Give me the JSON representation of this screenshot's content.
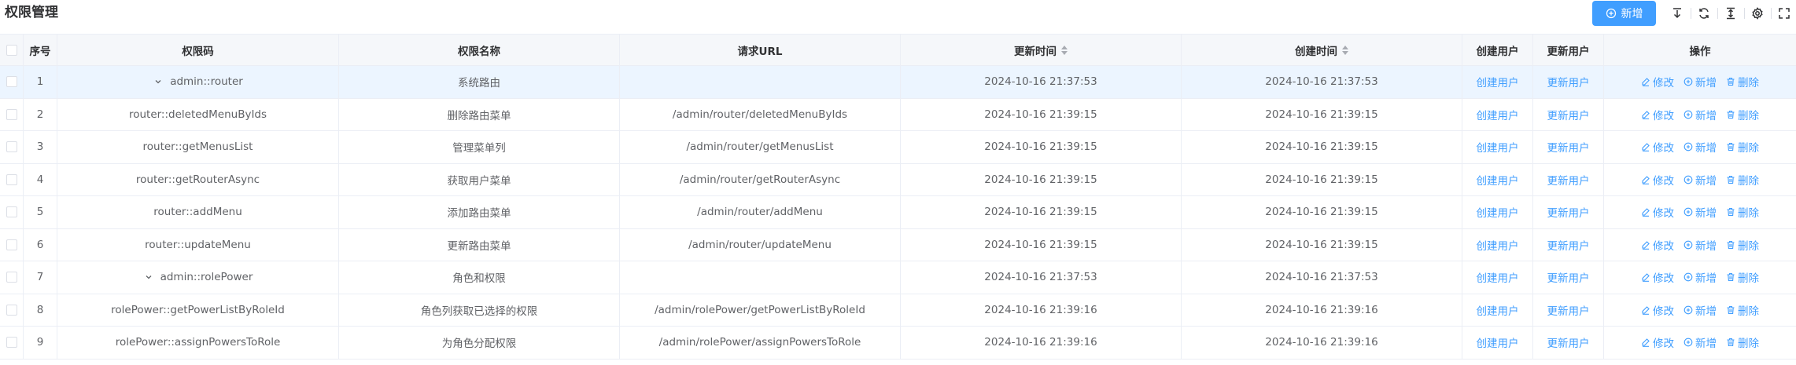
{
  "header": {
    "title": "权限管理",
    "add_label": "新增"
  },
  "toolbar": {
    "icons": [
      "export-icon",
      "refresh-icon",
      "column-height-icon",
      "settings-icon",
      "fullscreen-icon"
    ]
  },
  "columns": {
    "seq": "序号",
    "code": "权限码",
    "name": "权限名称",
    "url": "请求URL",
    "updated": "更新时间",
    "created": "创建时间",
    "create_user": "创建用户",
    "update_user": "更新用户",
    "ops": "操作"
  },
  "ops_labels": {
    "edit": "修改",
    "add": "新增",
    "delete": "删除"
  },
  "rows": [
    {
      "seq": "1",
      "code": "admin::router",
      "name": "系统路由",
      "url": "",
      "updated": "2024-10-16 21:37:53",
      "created": "2024-10-16 21:37:53",
      "create_user": "创建用户",
      "update_user": "更新用户"
    },
    {
      "seq": "2",
      "code": "router::deletedMenuByIds",
      "name": "删除路由菜单",
      "url": "/admin/router/deletedMenuByIds",
      "updated": "2024-10-16 21:39:15",
      "created": "2024-10-16 21:39:15",
      "create_user": "创建用户",
      "update_user": "更新用户"
    },
    {
      "seq": "3",
      "code": "router::getMenusList",
      "name": "管理菜单列",
      "url": "/admin/router/getMenusList",
      "updated": "2024-10-16 21:39:15",
      "created": "2024-10-16 21:39:15",
      "create_user": "创建用户",
      "update_user": "更新用户"
    },
    {
      "seq": "4",
      "code": "router::getRouterAsync",
      "name": "获取用户菜单",
      "url": "/admin/router/getRouterAsync",
      "updated": "2024-10-16 21:39:15",
      "created": "2024-10-16 21:39:15",
      "create_user": "创建用户",
      "update_user": "更新用户"
    },
    {
      "seq": "5",
      "code": "router::addMenu",
      "name": "添加路由菜单",
      "url": "/admin/router/addMenu",
      "updated": "2024-10-16 21:39:15",
      "created": "2024-10-16 21:39:15",
      "create_user": "创建用户",
      "update_user": "更新用户"
    },
    {
      "seq": "6",
      "code": "router::updateMenu",
      "name": "更新路由菜单",
      "url": "/admin/router/updateMenu",
      "updated": "2024-10-16 21:39:15",
      "created": "2024-10-16 21:39:15",
      "create_user": "创建用户",
      "update_user": "更新用户"
    },
    {
      "seq": "7",
      "code": "admin::rolePower",
      "name": "角色和权限",
      "url": "",
      "updated": "2024-10-16 21:37:53",
      "created": "2024-10-16 21:37:53",
      "create_user": "创建用户",
      "update_user": "更新用户"
    },
    {
      "seq": "8",
      "code": "rolePower::getPowerListByRoleId",
      "name": "角色列获取已选择的权限",
      "url": "/admin/rolePower/getPowerListByRoleId",
      "updated": "2024-10-16 21:39:16",
      "created": "2024-10-16 21:39:16",
      "create_user": "创建用户",
      "update_user": "更新用户"
    },
    {
      "seq": "9",
      "code": "rolePower::assignPowersToRole",
      "name": "为角色分配权限",
      "url": "/admin/rolePower/assignPowersToRole",
      "updated": "2024-10-16 21:39:16",
      "created": "2024-10-16 21:39:16",
      "create_user": "创建用户",
      "update_user": "更新用户"
    }
  ]
}
